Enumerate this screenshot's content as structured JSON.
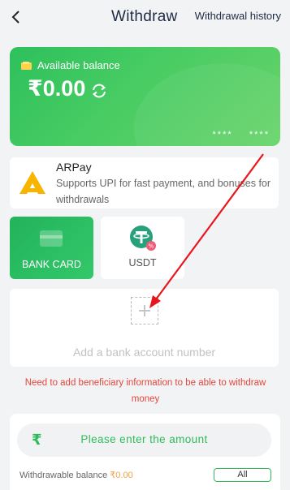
{
  "header": {
    "title": "Withdraw",
    "history_label": "Withdrawal history"
  },
  "balance": {
    "label": "Available balance",
    "amount": "₹0.00",
    "card_mask_1": "****",
    "card_mask_2": "****"
  },
  "arpay": {
    "name": "ARPay",
    "description": "Supports UPI for fast payment, and bonuses for withdrawals"
  },
  "methods": [
    {
      "label": "BANK CARD",
      "icon": "bank-card-icon",
      "selected": true
    },
    {
      "label": "USDT",
      "icon": "usdt-icon",
      "selected": false
    }
  ],
  "add_bank": {
    "label": "Add a bank account number"
  },
  "warning": "Need to add beneficiary information to be able to withdraw money",
  "amount": {
    "currency_symbol": "₹",
    "placeholder": "Please enter the amount",
    "withdrawable_label": "Withdrawable balance ",
    "withdrawable_value": "₹0.00",
    "all_label": "All"
  },
  "colors": {
    "accent": "#2fbb5a",
    "warning": "#e5453b",
    "orange": "#f2a145"
  }
}
